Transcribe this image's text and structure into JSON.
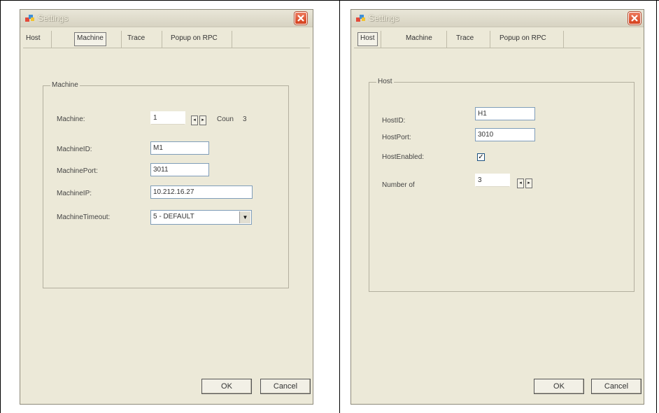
{
  "left_window": {
    "title": "Settings",
    "tabs": [
      "Host",
      "Machine",
      "Trace",
      "Popup on RPC"
    ],
    "group_title": "Machine",
    "machine_label": "Machine:",
    "machine_value": "1",
    "count_label": "Coun",
    "count_value": "3",
    "machine_id_label": "MachineID:",
    "machine_id_value": "M1",
    "machine_port_label": "MachinePort:",
    "machine_port_value": "3011",
    "machine_ip_label": "MachineIP:",
    "machine_ip_value": "10.212.16.27",
    "machine_timeout_label": "MachineTimeout:",
    "machine_timeout_value": "5 - DEFAULT",
    "ok_label": "OK",
    "cancel_label": "Cancel"
  },
  "right_window": {
    "title": "Settings",
    "tabs": [
      "Host",
      "Machine",
      "Trace",
      "Popup on RPC"
    ],
    "group_title": "Host",
    "host_id_label": "HostID:",
    "host_id_value": "H1",
    "host_port_label": "HostPort:",
    "host_port_value": "3010",
    "host_enabled_label": "HostEnabled:",
    "host_enabled_checked": true,
    "number_label": "Number of",
    "number_value": "3",
    "ok_label": "OK",
    "cancel_label": "Cancel"
  },
  "colors": {
    "dialog_bg": "#ece9d8",
    "title_text": "#f4f1e0",
    "close_button": "#d4401c",
    "field_border": "#7f9db9"
  },
  "icons": {
    "app": "settings-app-icon",
    "close": "close-icon",
    "spin_left": "spin-left-arrow",
    "spin_right": "spin-right-arrow",
    "dropdown": "chevron-down-icon",
    "check": "checkmark"
  }
}
